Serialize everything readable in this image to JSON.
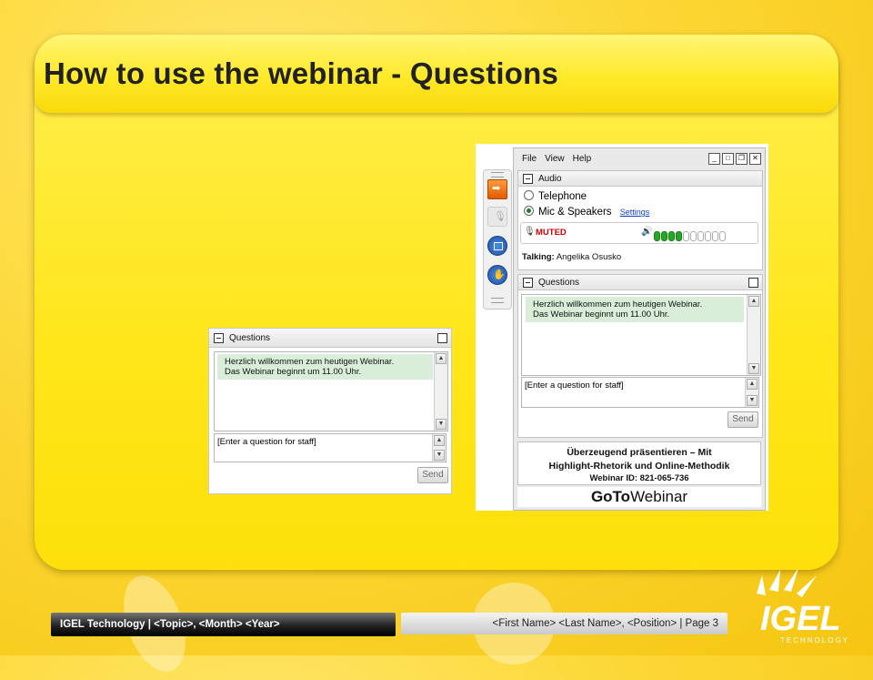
{
  "slide": {
    "title": "How to use the webinar - Questions",
    "page_label": "| Page 3"
  },
  "footer": {
    "left": "IGEL Technology | <Topic>, <Month> <Year>",
    "right": "<First Name> <Last Name>, <Position> | Page 3"
  },
  "small_panel": {
    "header": "Questions",
    "message_line1": "Herzlich willkommen zum heutigen Webinar.",
    "message_line2": "Das Webinar beginnt um 11.00 Uhr.",
    "input_text": "[Enter a question for staff]",
    "send_label": "Send"
  },
  "gtw_panel": {
    "menu": [
      "File",
      "View",
      "Help"
    ],
    "audio_header": "Audio",
    "opt_telephone": "Telephone",
    "opt_mic": "Mic & Speakers",
    "settings_link": "Settings",
    "muted_label": "MUTED",
    "talking_label": "Talking:",
    "talking_name": "Angelika Osusko",
    "questions_header": "Questions",
    "message_line1": "Herzlich willkommen zum heutigen Webinar.",
    "message_line2": "Das Webinar beginnt um 11.00 Uhr.",
    "input_text": "[Enter a question for staff]",
    "send_label": "Send",
    "webinar_title_line1": "Überzeugend präsentieren – Mit",
    "webinar_title_line2": "Highlight-Rhetorik und Online-Methodik",
    "webinar_id": "Webinar ID: 821-065-736",
    "brand_goto": "GoTo",
    "brand_webinar": "Webinar",
    "meter_level": 0.4
  },
  "logo": {
    "text": "IGEL",
    "tagline": "TECHNOLOGY"
  },
  "colors": {
    "accent_yellow": "#ffe619",
    "message_green": "#d8eed8",
    "link_blue": "#0a3ecf",
    "muted_red": "#cc0000"
  }
}
